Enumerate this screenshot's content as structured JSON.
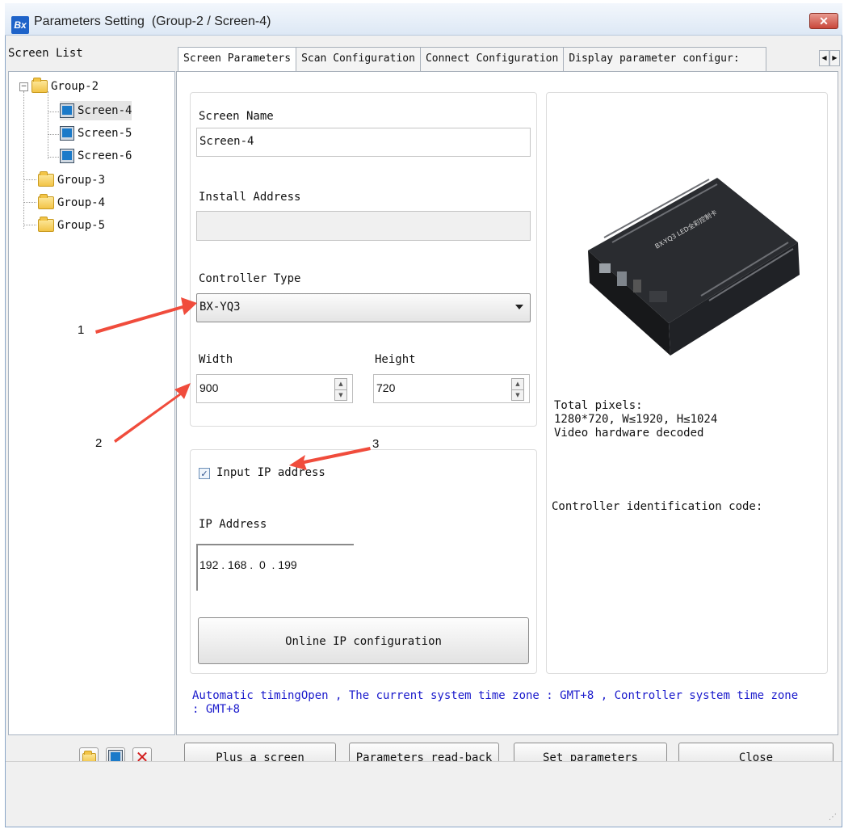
{
  "window": {
    "title": "Parameters Setting",
    "subtitle": "(Group-2 / Screen-4)",
    "logo": "Bx",
    "close_label": "✕"
  },
  "sidebar": {
    "label": "Screen List",
    "groups": [
      {
        "label": "Group-2",
        "expander": "−",
        "screens": [
          "Screen-4",
          "Screen-5",
          "Screen-6"
        ]
      },
      {
        "label": "Group-3"
      },
      {
        "label": "Group-4"
      },
      {
        "label": "Group-5"
      }
    ],
    "selected": "Screen-4"
  },
  "tabs": [
    {
      "label": "Screen Parameters",
      "active": true
    },
    {
      "label": "Scan Configuration"
    },
    {
      "label": "Connect Configuration"
    },
    {
      "label": "Display parameter configur:"
    }
  ],
  "tab_scroll": {
    "left": "◀",
    "right": "▶"
  },
  "form": {
    "screen_name_label": "Screen Name",
    "screen_name_value": "Screen-4",
    "install_address_label": "Install Address",
    "install_address_value": "",
    "controller_type_label": "Controller Type",
    "controller_type_value": "BX-YQ3",
    "width_label": "Width",
    "width_value": "900",
    "height_label": "Height",
    "height_value": "720",
    "spin_up": "▲",
    "spin_down": "▼",
    "input_ip_label": "Input IP address",
    "input_ip_checked": "✓",
    "ip_address_label": "IP Address",
    "ip_address_value": "192 . 168 .  0  . 199",
    "online_ip_button": "Online IP configuration"
  },
  "controller_info": {
    "total_pixels_label": "Total pixels:",
    "total_pixels_value": "1280*720, W≤1920, H≤1024",
    "video_decoding": "Video hardware decoded",
    "identification_code_label": "Controller identification code:",
    "device_label": "BX-YQ3 LED全彩控制卡"
  },
  "status_message": {
    "line1": "Automatic timingOpen , The current system time zone : GMT+8 , Controller system time zone",
    "line2": ": GMT+8",
    "color": "#1a1acc"
  },
  "toolbar": {
    "add_group_icon": "folder-icon",
    "add_screen_icon": "monitor-icon",
    "delete_icon": "x-icon",
    "delete_glyph": "✕",
    "plus_screen": "Plus a screen",
    "read_back": "Parameters read-back",
    "set_parameters": "Set parameters",
    "close": "Close"
  },
  "annotations": {
    "arrow1": "1",
    "arrow2": "2",
    "arrow3": "3",
    "color": "#f04c3c"
  }
}
